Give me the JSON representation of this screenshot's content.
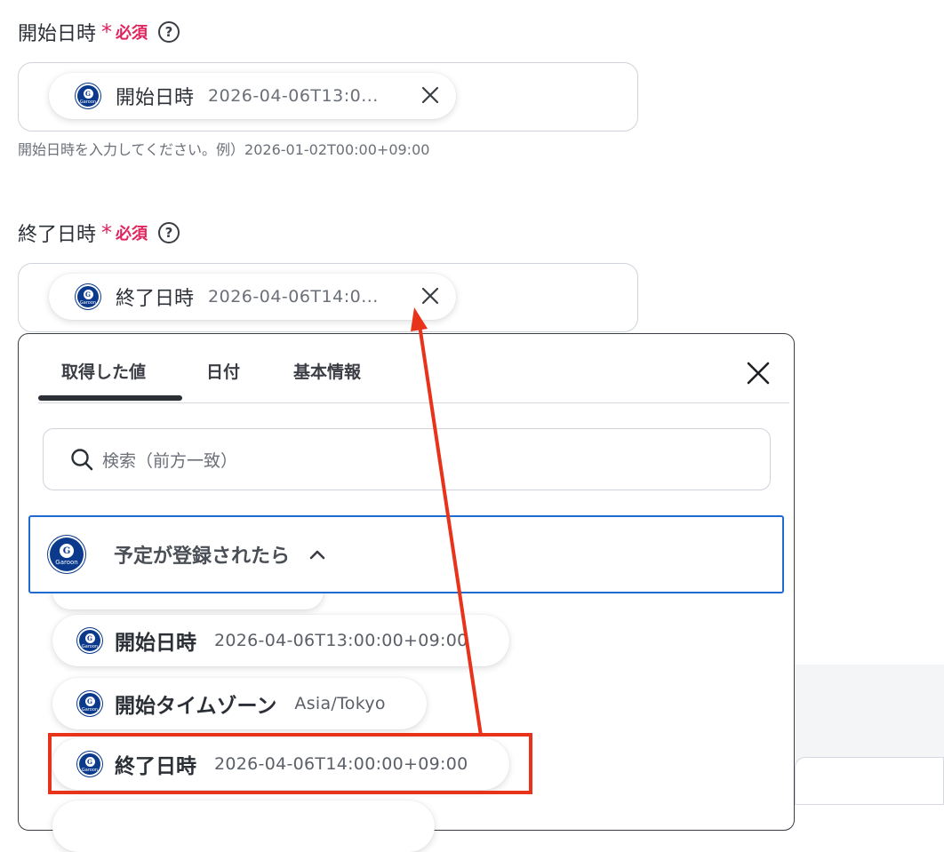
{
  "start_field": {
    "label": "開始日時",
    "required_star": "*",
    "required_text": "必須",
    "help": "?",
    "chip_label": "開始日時",
    "chip_value": "2026-04-06T13:0...",
    "hint": "開始日時を入力してください。例）2026-01-02T00:00+09:00"
  },
  "end_field": {
    "label": "終了日時",
    "required_star": "*",
    "required_text": "必須",
    "help": "?",
    "chip_label": "終了日時",
    "chip_value": "2026-04-06T14:0..."
  },
  "logo": {
    "letter": "G",
    "word": "Garoon"
  },
  "popup": {
    "tabs": [
      "取得した値",
      "日付",
      "基本情報"
    ],
    "search_placeholder": "検索（前方一致）",
    "group_title": "予定が登録されたら",
    "items": [
      {
        "label": "開始日時",
        "value": "2026-04-06T13:00:00+09:00"
      },
      {
        "label": "開始タイムゾーン",
        "value": "Asia/Tokyo"
      },
      {
        "label": "終了日時",
        "value": "2026-04-06T14:00:00+09:00"
      }
    ]
  },
  "colors": {
    "required": "#e0245e",
    "accent_blue": "#1f6bd1",
    "highlight_red": "#e8321a",
    "garoon_blue": "#0b3a8c"
  }
}
